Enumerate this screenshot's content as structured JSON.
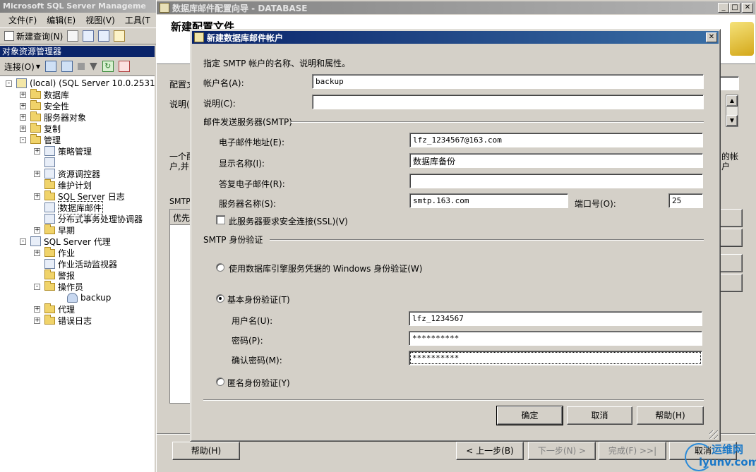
{
  "ssms": {
    "title": "Microsoft SQL Server Manageme",
    "menu": [
      "文件(F)",
      "编辑(E)",
      "视图(V)",
      "工具(T"
    ],
    "toolbar_new_query": "新建查询(N)",
    "object_explorer_title": "对象资源管理器",
    "connect_label": "连接(O)",
    "tree": [
      {
        "label": "(local) (SQL Server 10.0.2531",
        "depth": 0,
        "exp": "-",
        "icon": "server"
      },
      {
        "label": "数据库",
        "depth": 1,
        "exp": "+",
        "icon": "folder"
      },
      {
        "label": "安全性",
        "depth": 1,
        "exp": "+",
        "icon": "folder"
      },
      {
        "label": "服务器对象",
        "depth": 1,
        "exp": "+",
        "icon": "folder"
      },
      {
        "label": "复制",
        "depth": 1,
        "exp": "+",
        "icon": "folder"
      },
      {
        "label": "管理",
        "depth": 1,
        "exp": "-",
        "icon": "folder"
      },
      {
        "label": "策略管理",
        "depth": 2,
        "exp": "+",
        "icon": "item"
      },
      {
        "label": "",
        "depth": 2,
        "exp": "",
        "icon": "item"
      },
      {
        "label": "资源调控器",
        "depth": 2,
        "exp": "+",
        "icon": "item"
      },
      {
        "label": "维护计划",
        "depth": 2,
        "exp": "",
        "icon": "folder"
      },
      {
        "label": "SQL Server 日志",
        "depth": 2,
        "exp": "+",
        "icon": "folder"
      },
      {
        "label": "数据库邮件",
        "depth": 2,
        "exp": "",
        "icon": "item",
        "selected": true
      },
      {
        "label": "分布式事务处理协调器",
        "depth": 2,
        "exp": "",
        "icon": "item"
      },
      {
        "label": "早期",
        "depth": 2,
        "exp": "+",
        "icon": "folder"
      },
      {
        "label": "SQL Server 代理",
        "depth": 1,
        "exp": "-",
        "icon": "item"
      },
      {
        "label": "作业",
        "depth": 2,
        "exp": "+",
        "icon": "folder"
      },
      {
        "label": "作业活动监视器",
        "depth": 2,
        "exp": "",
        "icon": "item"
      },
      {
        "label": "警报",
        "depth": 2,
        "exp": "",
        "icon": "folder"
      },
      {
        "label": "操作员",
        "depth": 2,
        "exp": "-",
        "icon": "folder"
      },
      {
        "label": "backup",
        "depth": 3,
        "exp": "",
        "icon": "user"
      },
      {
        "label": "代理",
        "depth": 2,
        "exp": "+",
        "icon": "folder"
      },
      {
        "label": "错误日志",
        "depth": 2,
        "exp": "+",
        "icon": "folder"
      }
    ]
  },
  "wizard": {
    "title": "数据库邮件配置向导 - DATABASE",
    "header_title": "新建配置文件",
    "profile_name_label": "配置文",
    "description_label": "说明(",
    "info_text_1": "一个配",
    "info_text_2": "户,并",
    "info_right": "的帐",
    "info_right_2": "户",
    "smtp_label": "SMTP",
    "list_header": "优先",
    "help_button": "帮助(H)",
    "back_button": "< 上一步(B)",
    "next_button": "下一步(N) >",
    "finish_button": "完成(F) >>|",
    "cancel_button": "取消"
  },
  "dialog": {
    "title": "新建数据库邮件帐户",
    "intro": "指定 SMTP 帐户的名称、说明和属性。",
    "account_name_label": "帐户名(A):",
    "account_name_value": "backup",
    "description_label": "说明(C):",
    "description_value": "",
    "smtp_group": "邮件发送服务器(SMTP)",
    "email_label": "电子邮件地址(E):",
    "email_value": "lfz_1234567@163.com",
    "display_name_label": "显示名称(I):",
    "display_name_value": "数据库备份",
    "reply_label": "答复电子邮件(R):",
    "reply_value": "",
    "server_label": "服务器名称(S):",
    "server_value": "smtp.163.com",
    "port_label": "端口号(O):",
    "port_value": "25",
    "ssl_label": "此服务器要求安全连接(SSL)(V)",
    "ssl_checked": false,
    "auth_group": "SMTP 身份验证",
    "auth_windows_label": "使用数据库引擎服务凭据的 Windows 身份验证(W)",
    "auth_basic_label": "基本身份验证(T)",
    "auth_anon_label": "匿名身份验证(Y)",
    "auth_selected": "basic",
    "username_label": "用户名(U):",
    "username_value": "lfz_1234567",
    "password_label": "密码(P):",
    "password_value": "**********",
    "confirm_label": "确认密码(M):",
    "confirm_value": "**********",
    "ok_button": "确定",
    "cancel_button": "取消",
    "help_button": "帮助(H)"
  },
  "watermark": {
    "line1": "运维网",
    "line2": "iyunv.com"
  }
}
